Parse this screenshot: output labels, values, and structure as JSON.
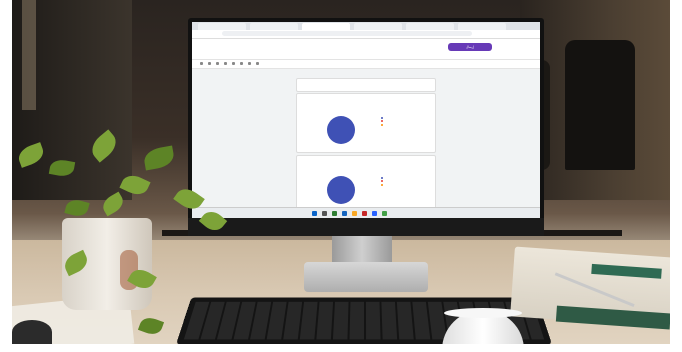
{
  "scene": {
    "description": "",
    "screen": {
      "send_button_label": "إرسال",
      "form_title": "",
      "header_text": "",
      "tabs": [
        "الأسئلة",
        "الردود",
        "الإعدادات"
      ],
      "cards": [
        {
          "title": "",
          "subtitle": "",
          "copy_label": "",
          "pie_label": "",
          "legend": [
            {
              "color": "#3f51b5",
              "label": ""
            },
            {
              "color": "#e53935",
              "label": ""
            },
            {
              "color": "#fb8c00",
              "label": ""
            }
          ]
        },
        {
          "title": "",
          "subtitle": "",
          "copy_label": "",
          "pie_label": "",
          "legend": [
            {
              "color": "#3f51b5",
              "label": ""
            },
            {
              "color": "#e53935",
              "label": ""
            },
            {
              "color": "#fb8c00",
              "label": ""
            }
          ]
        }
      ]
    },
    "colors": {
      "brand": "#673ab7",
      "pie": "#3f51b5"
    }
  }
}
